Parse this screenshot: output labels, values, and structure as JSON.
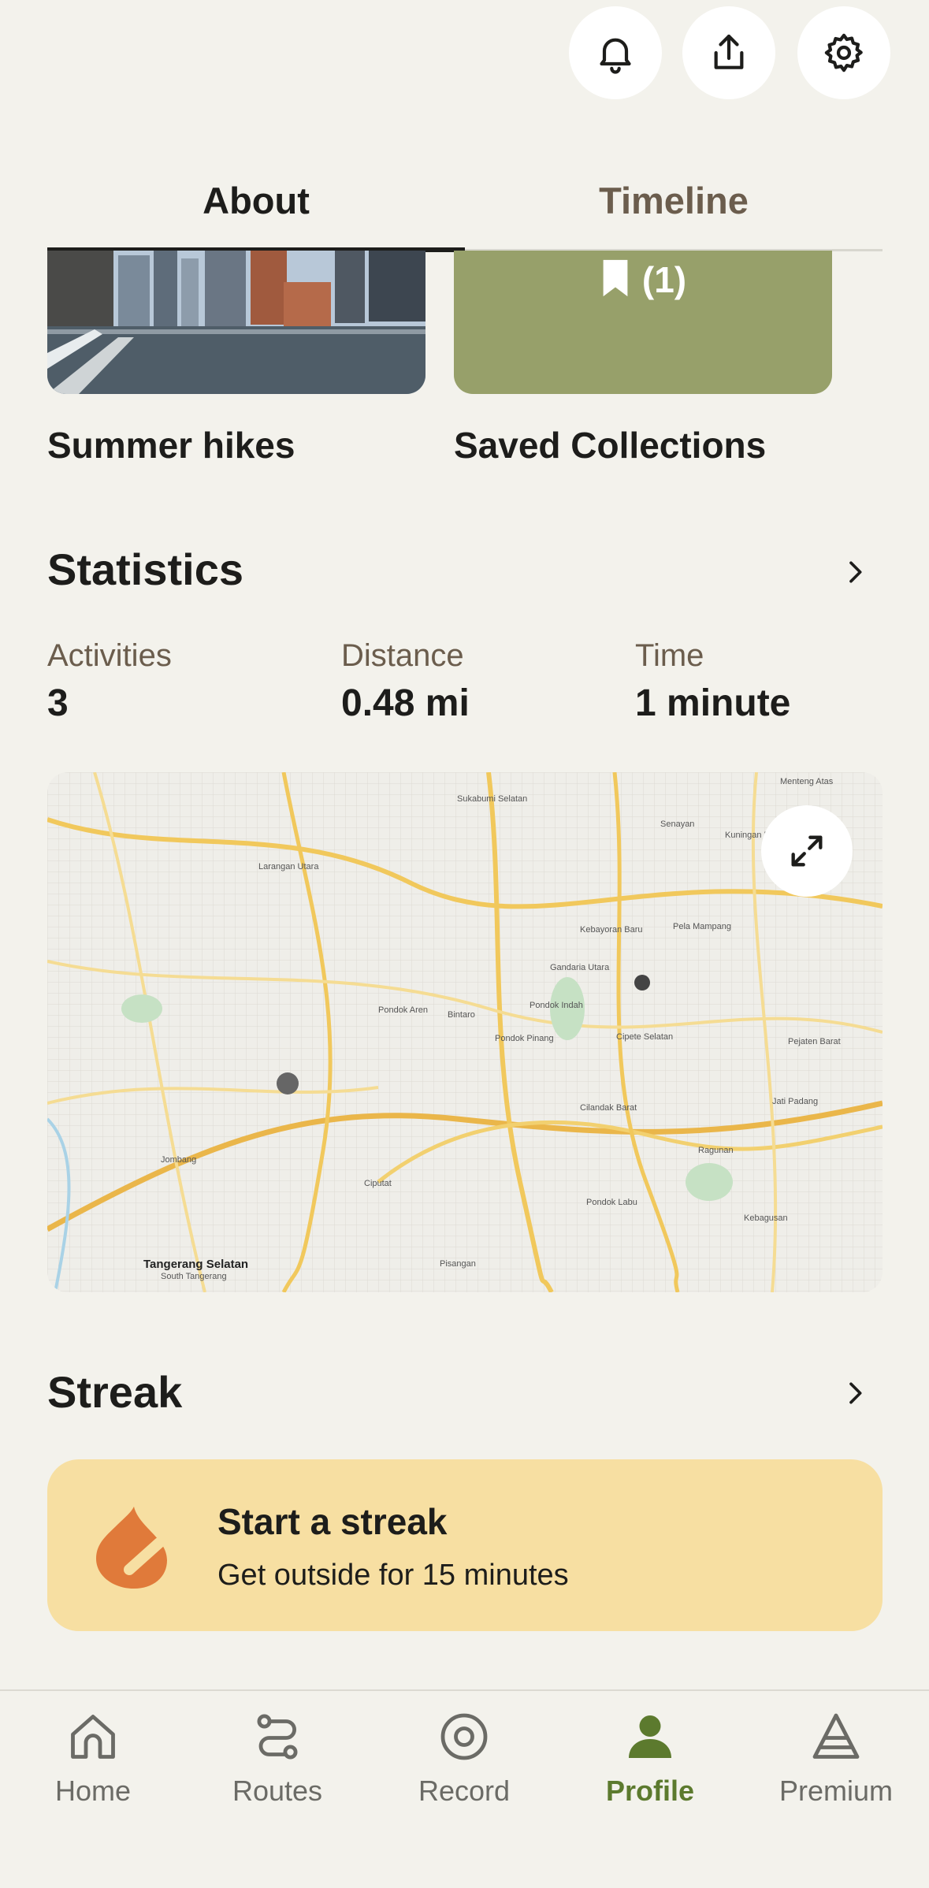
{
  "header": {
    "icons": [
      "bell-icon",
      "share-icon",
      "gear-icon"
    ]
  },
  "tabs": [
    {
      "label": "About",
      "active": true
    },
    {
      "label": "Timeline",
      "active": false
    }
  ],
  "collections": [
    {
      "title": "Summer hikes",
      "thumbnail": "city-river-photo"
    },
    {
      "title": "Saved Collections",
      "badge": "(1)",
      "color": "#97a06a"
    }
  ],
  "statistics": {
    "title": "Statistics",
    "items": [
      {
        "label": "Activities",
        "value": "3"
      },
      {
        "label": "Distance",
        "value": "0.48 mi"
      },
      {
        "label": "Time",
        "value": "1 minute"
      }
    ]
  },
  "map": {
    "labels": {
      "l1": "Tangerang Selatan",
      "l2": "South Tangerang",
      "l3": "Pondok Indah",
      "l4": "Senayan",
      "l5": "Kebayoran Baru",
      "l6": "Sukabumi Selatan",
      "l7": "Kuningan Barat",
      "l8": "Pondok Pinang",
      "l9": "Bintaro",
      "l10": "Cilandak Barat",
      "l11": "Pondok Labu",
      "l12": "Ciputat",
      "l13": "Pondok Aren",
      "l14": "Gandaria Utara",
      "l15": "Kebagusan",
      "l16": "Jati Padang",
      "l17": "Pejaten Barat",
      "l18": "Ragunan",
      "l19": "Pela Mampang",
      "l20": "Jombang",
      "l21": "Pisangan",
      "l22": "Menteng Atas",
      "l23": "Larangan Utara",
      "l24": "Cipete Selatan"
    }
  },
  "streak": {
    "title": "Streak",
    "card_title": "Start a streak",
    "card_subtitle": "Get outside for 15 minutes",
    "color": "#f7dfa2",
    "icon_color": "#e07a3a"
  },
  "nav": {
    "items": [
      {
        "label": "Home",
        "icon": "home-icon"
      },
      {
        "label": "Routes",
        "icon": "routes-icon"
      },
      {
        "label": "Record",
        "icon": "record-icon"
      },
      {
        "label": "Profile",
        "icon": "profile-icon",
        "active": true
      },
      {
        "label": "Premium",
        "icon": "premium-icon"
      }
    ],
    "active_color": "#5c7a2e"
  }
}
